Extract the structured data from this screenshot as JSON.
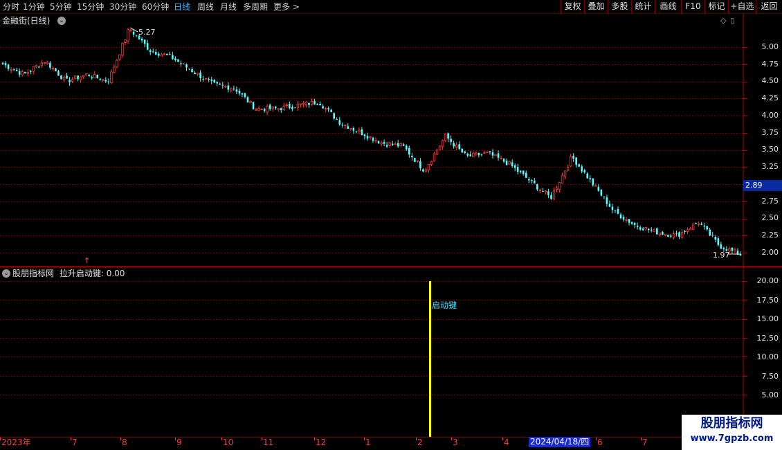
{
  "toolbar": {
    "periods": [
      "分时",
      "1分钟",
      "5分钟",
      "15分钟",
      "30分钟",
      "60分钟",
      "日线",
      "周线",
      "月线",
      "多周期",
      "更多 >"
    ],
    "active_period": "日线",
    "buttons": [
      "复权",
      "叠加",
      "多股",
      "统计",
      "画线",
      "F10",
      "标记",
      "+自选",
      "返回"
    ]
  },
  "price_panel": {
    "title": "金融街(日线)",
    "current_price": "2.89",
    "high_label": "5.27",
    "low_label": "1.97",
    "y_ticks": [
      "5.00",
      "4.75",
      "4.50",
      "4.25",
      "4.00",
      "3.75",
      "3.50",
      "3.25",
      "2.75",
      "2.50",
      "2.25",
      "2.00"
    ]
  },
  "indicator_panel": {
    "title": "股朋指标网",
    "formula": "拉升启动键: 0.00",
    "signal_label": "启动键",
    "y_ticks": [
      "20.00",
      "17.50",
      "15.00",
      "12.50",
      "10.00",
      "7.50",
      "5.00"
    ]
  },
  "date_axis": {
    "labels": [
      "2023年",
      "7",
      "8",
      "9",
      "10",
      "11",
      "12",
      "1",
      "2",
      "3",
      "4",
      "6",
      "7"
    ],
    "cursor_date": "2024/04/18/四"
  },
  "watermark": {
    "line1": "股朋指标网",
    "line2": "www.7gpzb.com"
  },
  "colors": {
    "up": "#ff3a3a",
    "down": "#54ffff",
    "signal_bar": "#ffff00",
    "grid": "#8a0000"
  },
  "chart_data": {
    "type": "line",
    "title": "金融街(日线)",
    "xlabel": "",
    "ylabel": "",
    "ylim": [
      1.9,
      5.5
    ],
    "x": [
      "2023年",
      "7",
      "8",
      "9",
      "10",
      "11",
      "12",
      "1",
      "2",
      "3",
      "4",
      "6",
      "7"
    ],
    "series": [
      {
        "values": [
          4.75,
          4.6,
          4.8,
          4.5,
          4.6,
          4.5,
          5.27,
          4.95,
          4.85,
          4.65,
          4.45,
          4.4,
          4.1,
          4.1,
          4.15,
          4.2,
          3.9,
          3.75,
          3.6,
          3.55,
          3.2,
          3.7,
          3.4,
          3.45,
          3.3,
          3.05,
          2.8,
          3.4,
          3.0,
          2.6,
          2.4,
          2.3,
          2.25,
          2.45,
          2.1,
          1.97
        ]
      }
    ]
  }
}
